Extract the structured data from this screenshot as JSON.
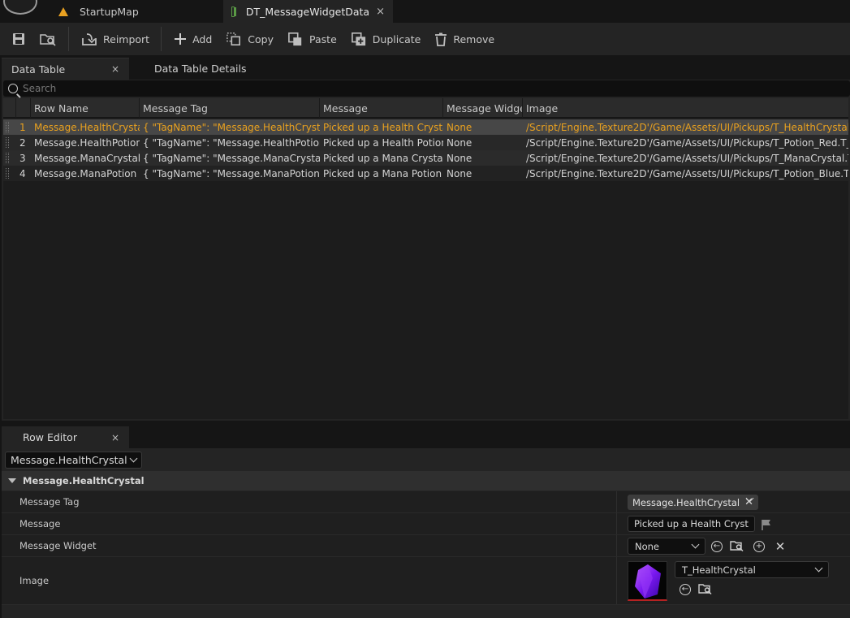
{
  "tabs": {
    "map_tab": "StartupMap",
    "asset_tab": "DT_MessageWidgetData",
    "close": "×"
  },
  "toolbar": {
    "reimport": "Reimport",
    "add": "Add",
    "copy": "Copy",
    "paste": "Paste",
    "duplicate": "Duplicate",
    "remove": "Remove"
  },
  "panels": {
    "data_table": "Data Table",
    "data_table_details": "Data Table Details",
    "close": "×"
  },
  "search": {
    "placeholder": "Search"
  },
  "table": {
    "columns": [
      "Row Name",
      "Message Tag",
      "Message",
      "Message Widget",
      "Image"
    ],
    "rows": [
      {
        "index": "1",
        "row_name": "Message.HealthCrystal",
        "tag": "{ \"TagName\": \"Message.HealthCrystal\" }",
        "message": "Picked up a Health Crystal",
        "widget": "None",
        "image": "/Script/Engine.Texture2D'/Game/Assets/UI/Pickups/T_HealthCrystal.T_HealthCrystal'"
      },
      {
        "index": "2",
        "row_name": "Message.HealthPotion",
        "tag": "{ \"TagName\": \"Message.HealthPotion\" }",
        "message": "Picked up a Health Potion",
        "widget": "None",
        "image": "/Script/Engine.Texture2D'/Game/Assets/UI/Pickups/T_Potion_Red.T_Potion_Red'"
      },
      {
        "index": "3",
        "row_name": "Message.ManaCrystal",
        "tag": "{ \"TagName\": \"Message.ManaCrystal\" }",
        "message": "Picked up a Mana Crystal",
        "widget": "None",
        "image": "/Script/Engine.Texture2D'/Game/Assets/UI/Pickups/T_ManaCrystal.T_ManaCrystal'"
      },
      {
        "index": "4",
        "row_name": "Message.ManaPotion",
        "tag": "{ \"TagName\": \"Message.ManaPotion\" }",
        "message": "Picked up a Mana Potion",
        "widget": "None",
        "image": "/Script/Engine.Texture2D'/Game/Assets/UI/Pickups/T_Potion_Blue.T_Potion_Blue'"
      }
    ]
  },
  "row_editor": {
    "tab": "Row Editor",
    "close": "×",
    "selected_row": "Message.HealthCrystal",
    "category": "Message.HealthCrystal",
    "props": {
      "message_tag_label": "Message Tag",
      "message_tag_value": "Message.HealthCrystal",
      "message_label": "Message",
      "message_value": "Picked up a Health Crystal",
      "widget_label": "Message Widget",
      "widget_value": "None",
      "image_label": "Image",
      "image_value": "T_HealthCrystal"
    }
  },
  "colors": {
    "selected_text": "#e9a11f",
    "background": "#242424",
    "crystal": "#7a18f0"
  }
}
